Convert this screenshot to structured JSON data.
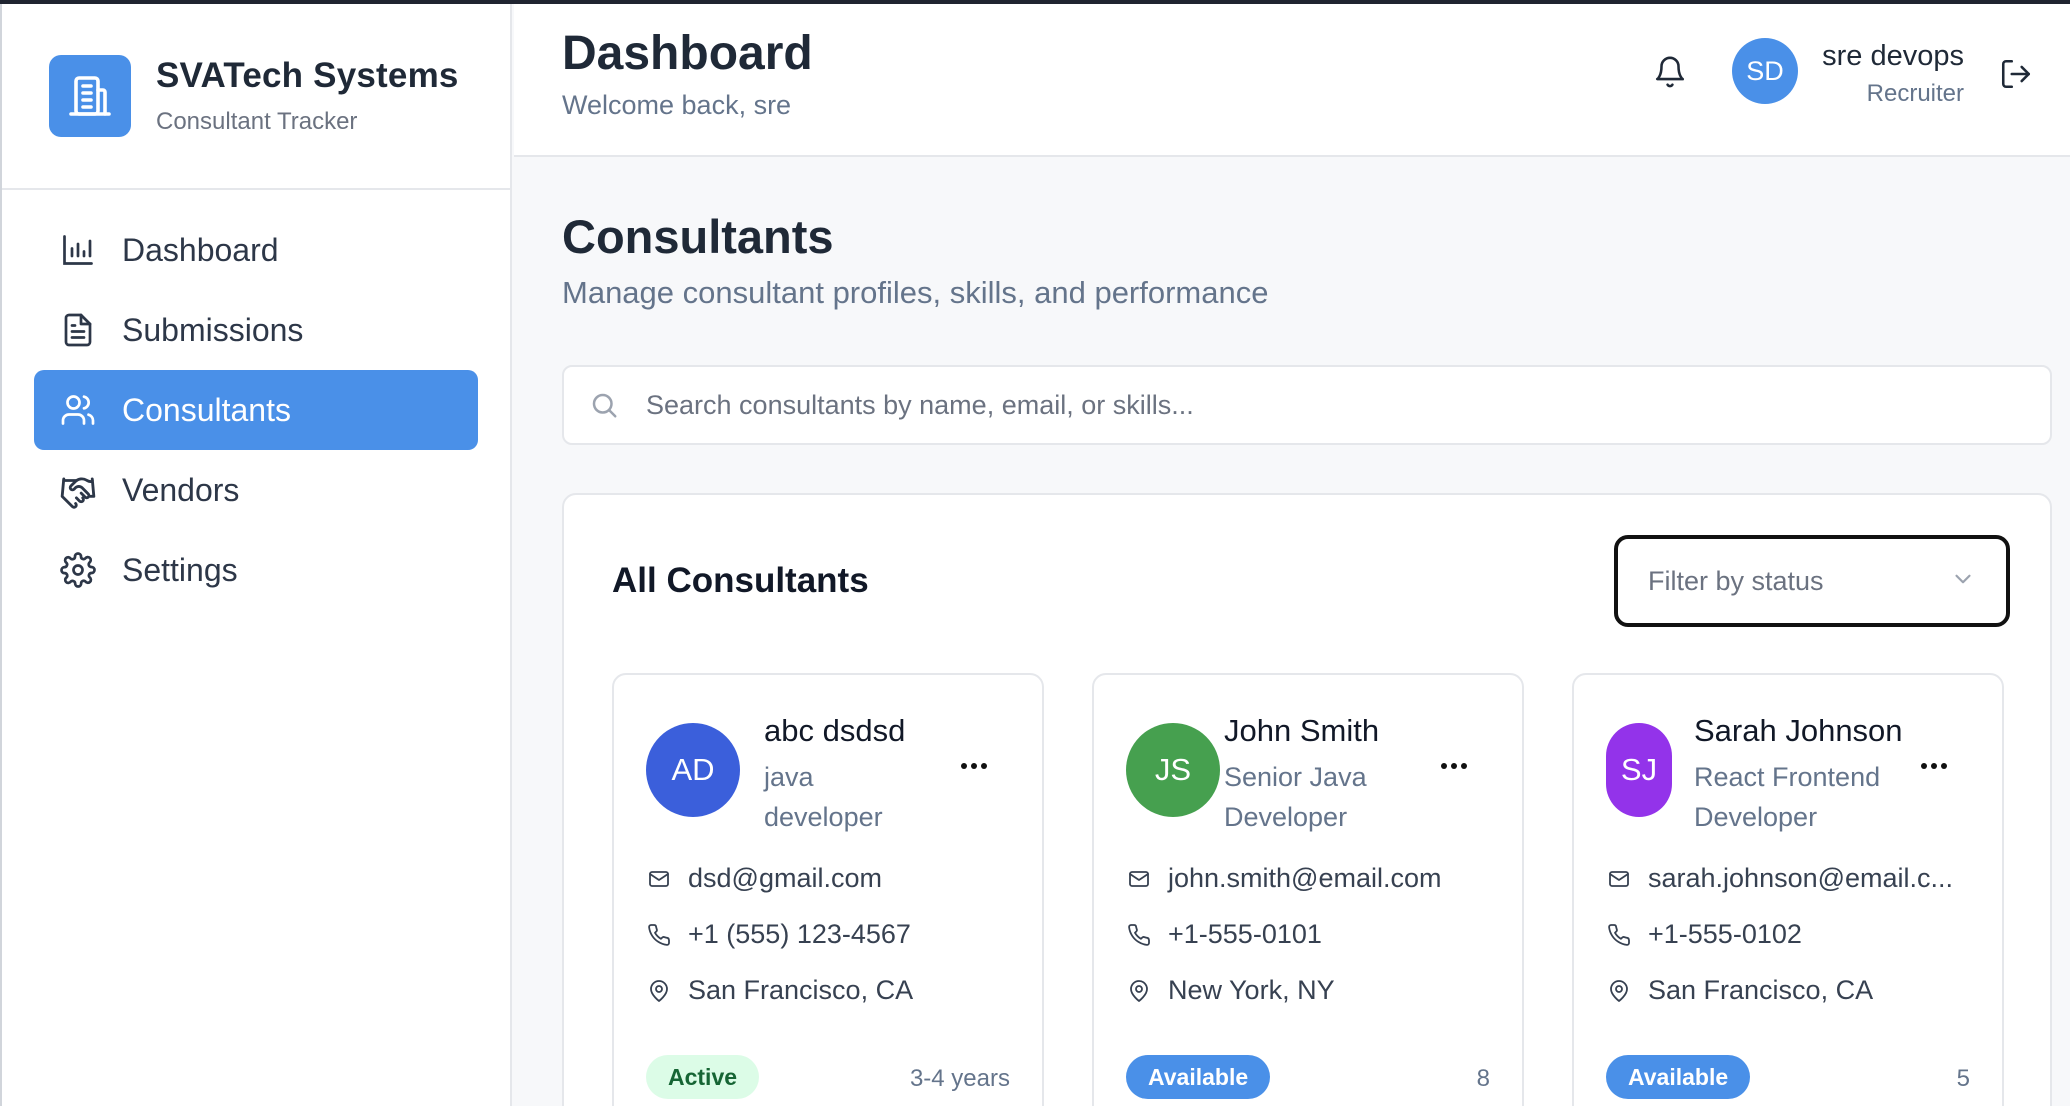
{
  "brand": {
    "name": "SVATech Systems",
    "subtitle": "Consultant Tracker",
    "icon": "building-icon",
    "color": "#4a90e8"
  },
  "sidebar": {
    "items": [
      {
        "label": "Dashboard",
        "icon": "bar-chart-icon",
        "active": false
      },
      {
        "label": "Submissions",
        "icon": "file-text-icon",
        "active": false
      },
      {
        "label": "Consultants",
        "icon": "users-icon",
        "active": true
      },
      {
        "label": "Vendors",
        "icon": "handshake-icon",
        "active": false
      },
      {
        "label": "Settings",
        "icon": "gear-icon",
        "active": false
      }
    ]
  },
  "header": {
    "title": "Dashboard",
    "welcome": "Welcome back, sre",
    "user": {
      "initials": "SD",
      "name": "sre devops",
      "role": "Recruiter"
    }
  },
  "main": {
    "title": "Consultants",
    "subtitle": "Manage consultant profiles, skills, and performance",
    "search": {
      "placeholder": "Search consultants by name, email, or skills...",
      "value": ""
    },
    "panel": {
      "title": "All Consultants",
      "filter_placeholder": "Filter by status",
      "cards": [
        {
          "initials": "AD",
          "avatar_color": "#3b5fdb",
          "name": "abc dsdsd",
          "role_line1": "java",
          "role_line2": "developer",
          "email": "dsd@gmail.com",
          "phone": "+1 (555) 123-4567",
          "location": "San Francisco, CA",
          "status": "Active",
          "experience": "3-4 years"
        },
        {
          "initials": "JS",
          "avatar_color": "#46a04f",
          "name": "John Smith",
          "role_line1": "Senior Java",
          "role_line2": "Developer",
          "email": "john.smith@email.com",
          "phone": "+1-555-0101",
          "location": "New York, NY",
          "status": "Available",
          "experience": "8"
        },
        {
          "initials": "SJ",
          "avatar_color": "#9333ea",
          "name": "Sarah Johnson",
          "role_line1": "React Frontend",
          "role_line2": "Developer",
          "email": "sarah.johnson@email.c...",
          "phone": "+1-555-0102",
          "location": "San Francisco, CA",
          "status": "Available",
          "experience": "5"
        }
      ]
    }
  }
}
